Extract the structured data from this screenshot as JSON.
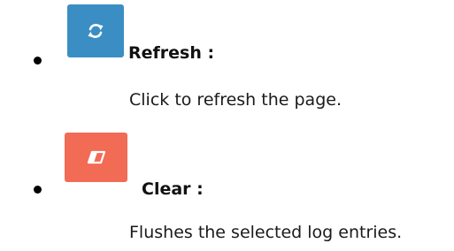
{
  "items": [
    {
      "title": "Refresh :",
      "description": "Click to refresh the page.",
      "icon": "refresh-icon",
      "button_color": "#3a8ec4"
    },
    {
      "title": "Clear :",
      "description": "Flushes the selected log entries.",
      "icon": "eraser-icon",
      "button_color": "#f26b55"
    }
  ]
}
